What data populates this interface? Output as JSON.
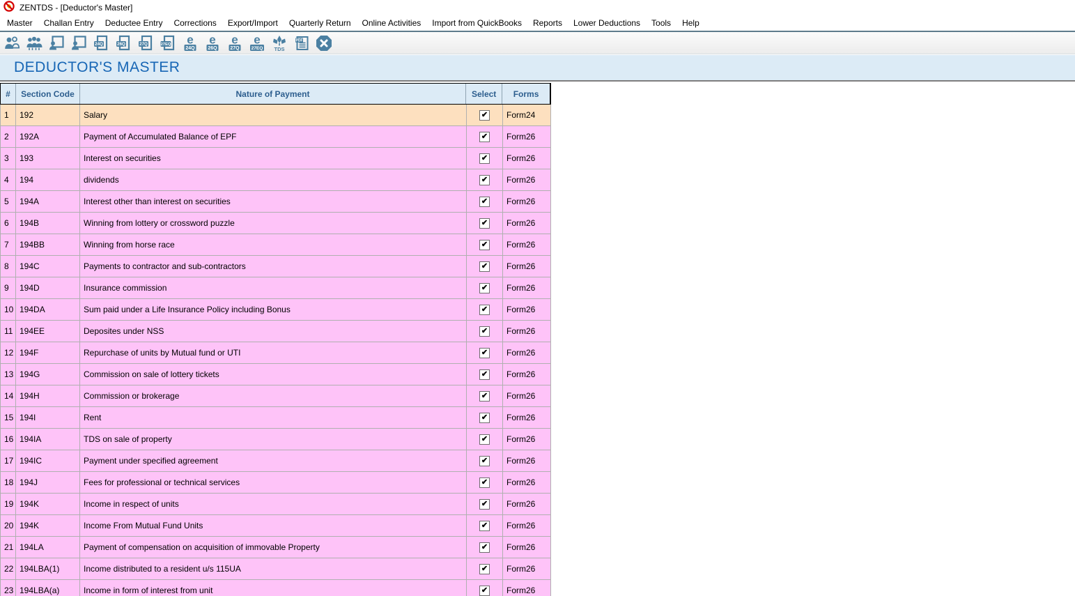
{
  "window": {
    "title": "ZENTDS - [Deductor's Master]"
  },
  "menu": {
    "items": [
      "Master",
      "Challan Entry",
      "Deductee Entry",
      "Corrections",
      "Export/Import",
      "Quarterly Return",
      "Online Activities",
      "Import from QuickBooks",
      "Reports",
      "Lower Deductions",
      "Tools",
      "Help"
    ]
  },
  "toolbar": {
    "icons": [
      {
        "name": "deductors-icon"
      },
      {
        "name": "deductees-icon"
      },
      {
        "name": "employee-master-icon"
      },
      {
        "name": "party-master-icon"
      },
      {
        "name": "form-24q-icon",
        "badge": "24Q"
      },
      {
        "name": "form-26q-icon",
        "badge": "26Q"
      },
      {
        "name": "form-27q-icon",
        "badge": "27Q"
      },
      {
        "name": "form-27eq-icon",
        "badge": "27EQ"
      },
      {
        "name": "e-return-24q-icon",
        "letter": "e",
        "badge": "24Q"
      },
      {
        "name": "e-return-26q-icon",
        "letter": "e",
        "badge": "26Q"
      },
      {
        "name": "e-return-27q-icon",
        "letter": "e",
        "badge": "27Q"
      },
      {
        "name": "e-return-27eq-icon",
        "letter": "e",
        "badge": "27EQ"
      },
      {
        "name": "tds-icon",
        "label": "TDS"
      },
      {
        "name": "pdf-report-icon",
        "label": "PDF"
      },
      {
        "name": "close-icon"
      }
    ]
  },
  "page": {
    "title": "DEDUCTOR'S MASTER"
  },
  "table": {
    "columns": [
      "#",
      "Section Code",
      "Nature of Payment",
      "Select",
      "Forms"
    ],
    "rows": [
      {
        "num": "1",
        "section": "192",
        "nature": "Salary",
        "selected": true,
        "form": "Form24",
        "highlight": true
      },
      {
        "num": "2",
        "section": "192A",
        "nature": "Payment of Accumulated Balance of EPF",
        "selected": true,
        "form": "Form26"
      },
      {
        "num": "3",
        "section": "193",
        "nature": "Interest on securities",
        "selected": true,
        "form": "Form26"
      },
      {
        "num": "4",
        "section": "194",
        "nature": "dividends",
        "selected": true,
        "form": "Form26"
      },
      {
        "num": "5",
        "section": "194A",
        "nature": "Interest other than interest on securities",
        "selected": true,
        "form": "Form26"
      },
      {
        "num": "6",
        "section": "194B",
        "nature": "Winning from lottery  or crossword puzzle",
        "selected": true,
        "form": "Form26"
      },
      {
        "num": "7",
        "section": "194BB",
        "nature": "Winning from horse race",
        "selected": true,
        "form": "Form26"
      },
      {
        "num": "8",
        "section": "194C",
        "nature": "Payments to contractor and sub-contractors",
        "selected": true,
        "form": "Form26"
      },
      {
        "num": "9",
        "section": "194D",
        "nature": "Insurance commission",
        "selected": true,
        "form": "Form26"
      },
      {
        "num": "10",
        "section": "194DA",
        "nature": "Sum paid under a Life Insurance Policy including Bonus",
        "selected": true,
        "form": "Form26"
      },
      {
        "num": "11",
        "section": "194EE",
        "nature": "Deposites under NSS",
        "selected": true,
        "form": "Form26"
      },
      {
        "num": "12",
        "section": "194F",
        "nature": "Repurchase of units by Mutual fund or UTI",
        "selected": true,
        "form": "Form26"
      },
      {
        "num": "13",
        "section": "194G",
        "nature": "Commission on sale of lottery tickets",
        "selected": true,
        "form": "Form26"
      },
      {
        "num": "14",
        "section": "194H",
        "nature": "Commission or brokerage",
        "selected": true,
        "form": "Form26"
      },
      {
        "num": "15",
        "section": "194I",
        "nature": "Rent",
        "selected": true,
        "form": "Form26"
      },
      {
        "num": "16",
        "section": "194IA",
        "nature": "TDS on sale of property",
        "selected": true,
        "form": "Form26"
      },
      {
        "num": "17",
        "section": "194IC",
        "nature": "Payment under specified agreement",
        "selected": true,
        "form": "Form26"
      },
      {
        "num": "18",
        "section": "194J",
        "nature": "Fees for professional or technical services",
        "selected": true,
        "form": "Form26"
      },
      {
        "num": "19",
        "section": "194K",
        "nature": "Income in respect of units",
        "selected": true,
        "form": "Form26"
      },
      {
        "num": "20",
        "section": "194K",
        "nature": "Income From Mutual Fund Units",
        "selected": true,
        "form": "Form26"
      },
      {
        "num": "21",
        "section": "194LA",
        "nature": "Payment of compensation on acquisition of immovable Property",
        "selected": true,
        "form": "Form26"
      },
      {
        "num": "22",
        "section": "194LBA(1)",
        "nature": "Income distributed to a resident u/s 115UA",
        "selected": true,
        "form": "Form26"
      },
      {
        "num": "23",
        "section": "194LBA(a)",
        "nature": "Income in form of interest from unit",
        "selected": true,
        "form": "Form26"
      }
    ]
  },
  "colors": {
    "accent_blue": "#1766b5",
    "header_text": "#2d5e8e",
    "row_pink": "#fec3f8",
    "row_highlight_peach": "#fde0bf",
    "icon_steel_blue": "#4b80a2",
    "band_light_blue": "#dcebf6"
  }
}
